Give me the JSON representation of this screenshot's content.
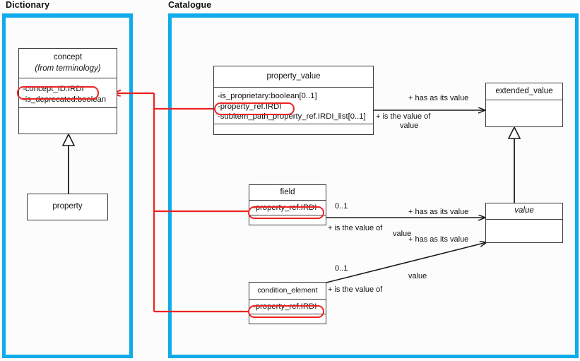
{
  "panels": [
    {
      "title": "Dictionary"
    },
    {
      "title": "Catalogue"
    }
  ],
  "colors": {
    "panel_border": "#0fabeb",
    "class_border": "#3a3a3a",
    "highlight": "#ee2222",
    "connector": "#ee2222",
    "text": "#111111",
    "background": "#fcfcfc"
  },
  "classes": {
    "concept": {
      "name": "concept",
      "stereotype": "(from terminology)",
      "attributes": [
        "-concept_ID.IRDI",
        "-is_deprecated:boolean"
      ]
    },
    "property": {
      "name": "property"
    },
    "property_value": {
      "name": "property_value",
      "attributes": [
        "-is_proprietary:boolean[0..1]",
        "-property_ref.IRDI",
        "-subitem_path_property_ref.IRDI_list[0..1]"
      ]
    },
    "extended_value": {
      "name": "extended_value"
    },
    "field": {
      "name": "field",
      "attributes": [
        "-property_ref.IRDI"
      ]
    },
    "value": {
      "name": "value"
    },
    "condition_element": {
      "name": "condition_element",
      "attributes": [
        "-property_ref.IRDI"
      ]
    }
  },
  "associations": {
    "property_value_to_extended_value": {
      "role_forward": "+ has as its value",
      "role_reverse": "+ is the value of",
      "role_name": "value"
    },
    "field_to_value": {
      "multiplicity": "0..1",
      "role_forward": "+ has as its value",
      "role_reverse": "+ is the value of",
      "role_name": "value"
    },
    "condition_element_to_value": {
      "multiplicity": "0..1",
      "role_forward": "+ has as its value",
      "role_reverse": "+ is the value of",
      "role_name": "value"
    }
  }
}
